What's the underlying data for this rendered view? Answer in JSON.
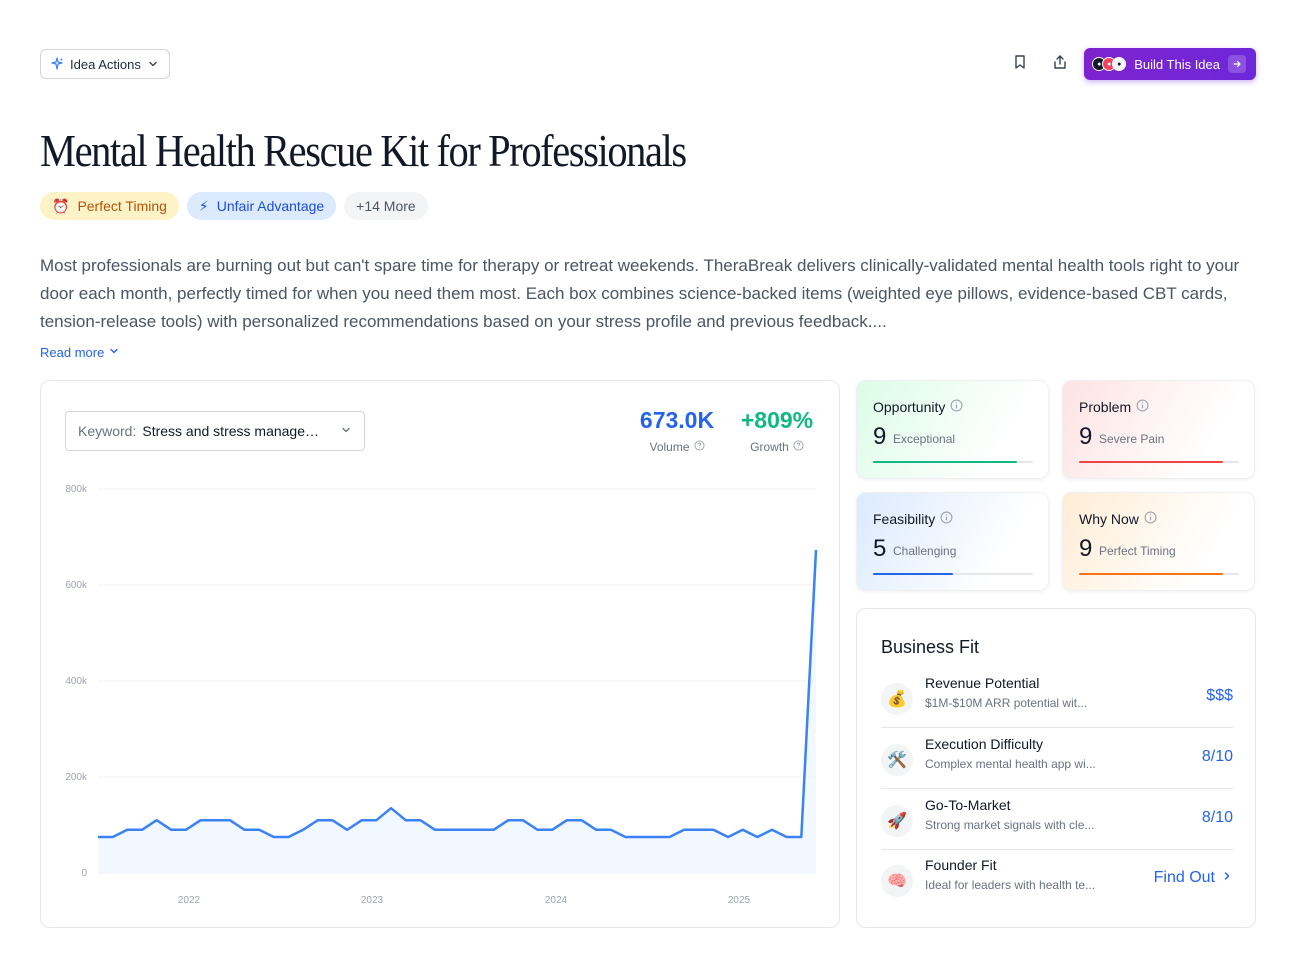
{
  "toolbar": {
    "idea_actions_label": "Idea Actions",
    "build_button_label": "Build This Idea"
  },
  "idea": {
    "title": "Mental Health Rescue Kit for Professionals",
    "badges": [
      {
        "icon": "alarm-clock-icon",
        "glyph": "⏰",
        "label": "Perfect Timing"
      },
      {
        "icon": "lightning-icon",
        "glyph": "⚡",
        "label": "Unfair Advantage"
      },
      {
        "label": "+14 More"
      }
    ],
    "description": "Most professionals are burning out but can't spare time for therapy or retreat weekends. TheraBreak delivers clinically-validated mental health tools right to your door each month, perfectly timed for when you need them most. Each box combines science-backed items (weighted eye pillows, evidence-based CBT cards, tension-release tools) with personalized recommendations based on your stress profile and previous feedback....",
    "read_more_label": "Read more"
  },
  "trend": {
    "keyword_label": "Keyword:",
    "keyword_value": "Stress and stress management",
    "volume_value": "673.0K",
    "volume_label": "Volume",
    "growth_value": "+809%",
    "growth_label": "Growth"
  },
  "chart_data": {
    "type": "area",
    "x_labels": [
      "2022",
      "2023",
      "2024",
      "2025"
    ],
    "y_ticks": [
      "800k",
      "600k",
      "400k",
      "200k",
      "0"
    ],
    "ylim": [
      0,
      800000
    ],
    "grid": true,
    "series": [
      {
        "color": "#3b82f6",
        "values": [
          75000,
          75000,
          90000,
          90000,
          110000,
          90000,
          90000,
          110000,
          110000,
          110000,
          90000,
          90000,
          75000,
          75000,
          90000,
          110000,
          110000,
          90000,
          110000,
          110000,
          135000,
          110000,
          110000,
          90000,
          90000,
          90000,
          90000,
          90000,
          110000,
          110000,
          90000,
          90000,
          110000,
          110000,
          90000,
          90000,
          75000,
          75000,
          75000,
          75000,
          90000,
          90000,
          90000,
          75000,
          90000,
          75000,
          90000,
          75000,
          75000,
          673000
        ]
      }
    ]
  },
  "scores": [
    {
      "key": "opportunity",
      "title": "Opportunity",
      "score": "9",
      "label": "Exceptional",
      "fill": 0.9,
      "color": "#10b981"
    },
    {
      "key": "problem",
      "title": "Problem",
      "score": "9",
      "label": "Severe Pain",
      "fill": 0.9,
      "color": "#ef4444"
    },
    {
      "key": "feasibility",
      "title": "Feasibility",
      "score": "5",
      "label": "Challenging",
      "fill": 0.5,
      "color": "#2563eb"
    },
    {
      "key": "why-now",
      "title": "Why Now",
      "score": "9",
      "label": "Perfect Timing",
      "fill": 0.9,
      "color": "#f97316"
    }
  ],
  "business_fit": {
    "title": "Business Fit",
    "rows": [
      {
        "icon": "money-bag-icon",
        "glyph": "💰",
        "name": "Revenue Potential",
        "desc": "$1M-$10M ARR potential wit...",
        "value": "$$$"
      },
      {
        "icon": "tools-icon",
        "glyph": "🛠️",
        "name": "Execution Difficulty",
        "desc": "Complex mental health app wi...",
        "value": "8/10"
      },
      {
        "icon": "rocket-icon",
        "glyph": "🚀",
        "name": "Go-To-Market",
        "desc": "Strong market signals with cle...",
        "value": "8/10"
      },
      {
        "icon": "brain-icon",
        "glyph": "🧠",
        "name": "Founder Fit",
        "desc": "Ideal for leaders with health te...",
        "value": "Find Out"
      }
    ]
  }
}
